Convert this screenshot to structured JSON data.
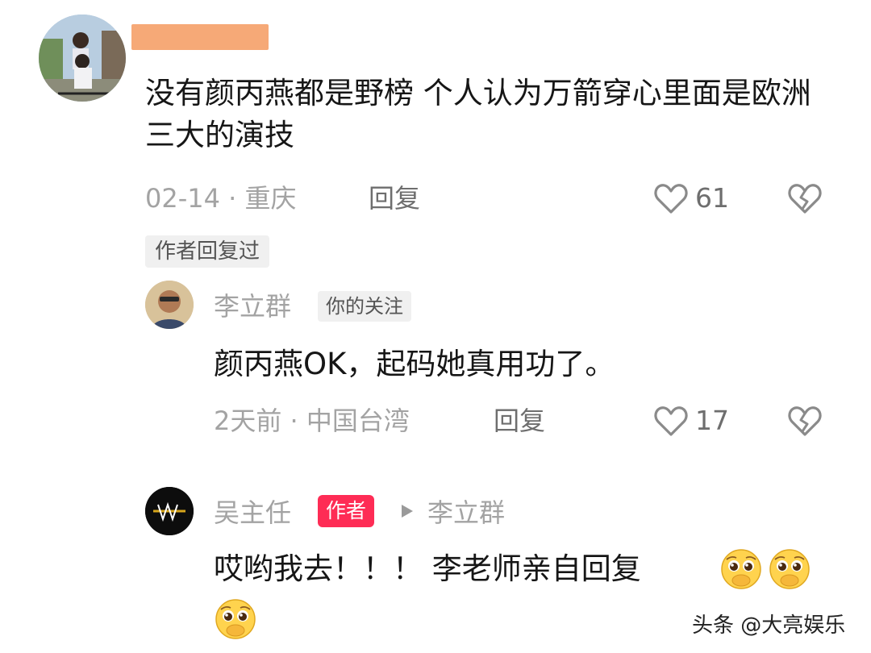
{
  "comments": [
    {
      "username": "",
      "text": "没有颜丙燕都是野榜 个人认为万箭穿心里面是欧洲三大的演技",
      "meta": "02-14 · 重庆",
      "reply_label": "回复",
      "likes": "61",
      "author_replied_tag": "作者回复过"
    },
    {
      "username": "李立群",
      "badge": "你的关注",
      "text": "颜丙燕OK，起码她真用功了。",
      "meta": "2天前 · 中国台湾",
      "reply_label": "回复",
      "likes": "17"
    },
    {
      "username": "吴主任",
      "badge": "作者",
      "reply_to": "李立群",
      "text": "哎哟我去！！！ 李老师亲自回复"
    }
  ],
  "watermark": "头条 @大亮娱乐",
  "icons": {
    "like": "heart-outline-icon",
    "dislike": "broken-heart-icon",
    "reply_arrow": "play-triangle-icon",
    "emoji": "pleading-face-emoji"
  },
  "colors": {
    "author_tag": "#fe2c55",
    "meta_text": "#a3a3a3",
    "redaction": "#f6a977"
  }
}
